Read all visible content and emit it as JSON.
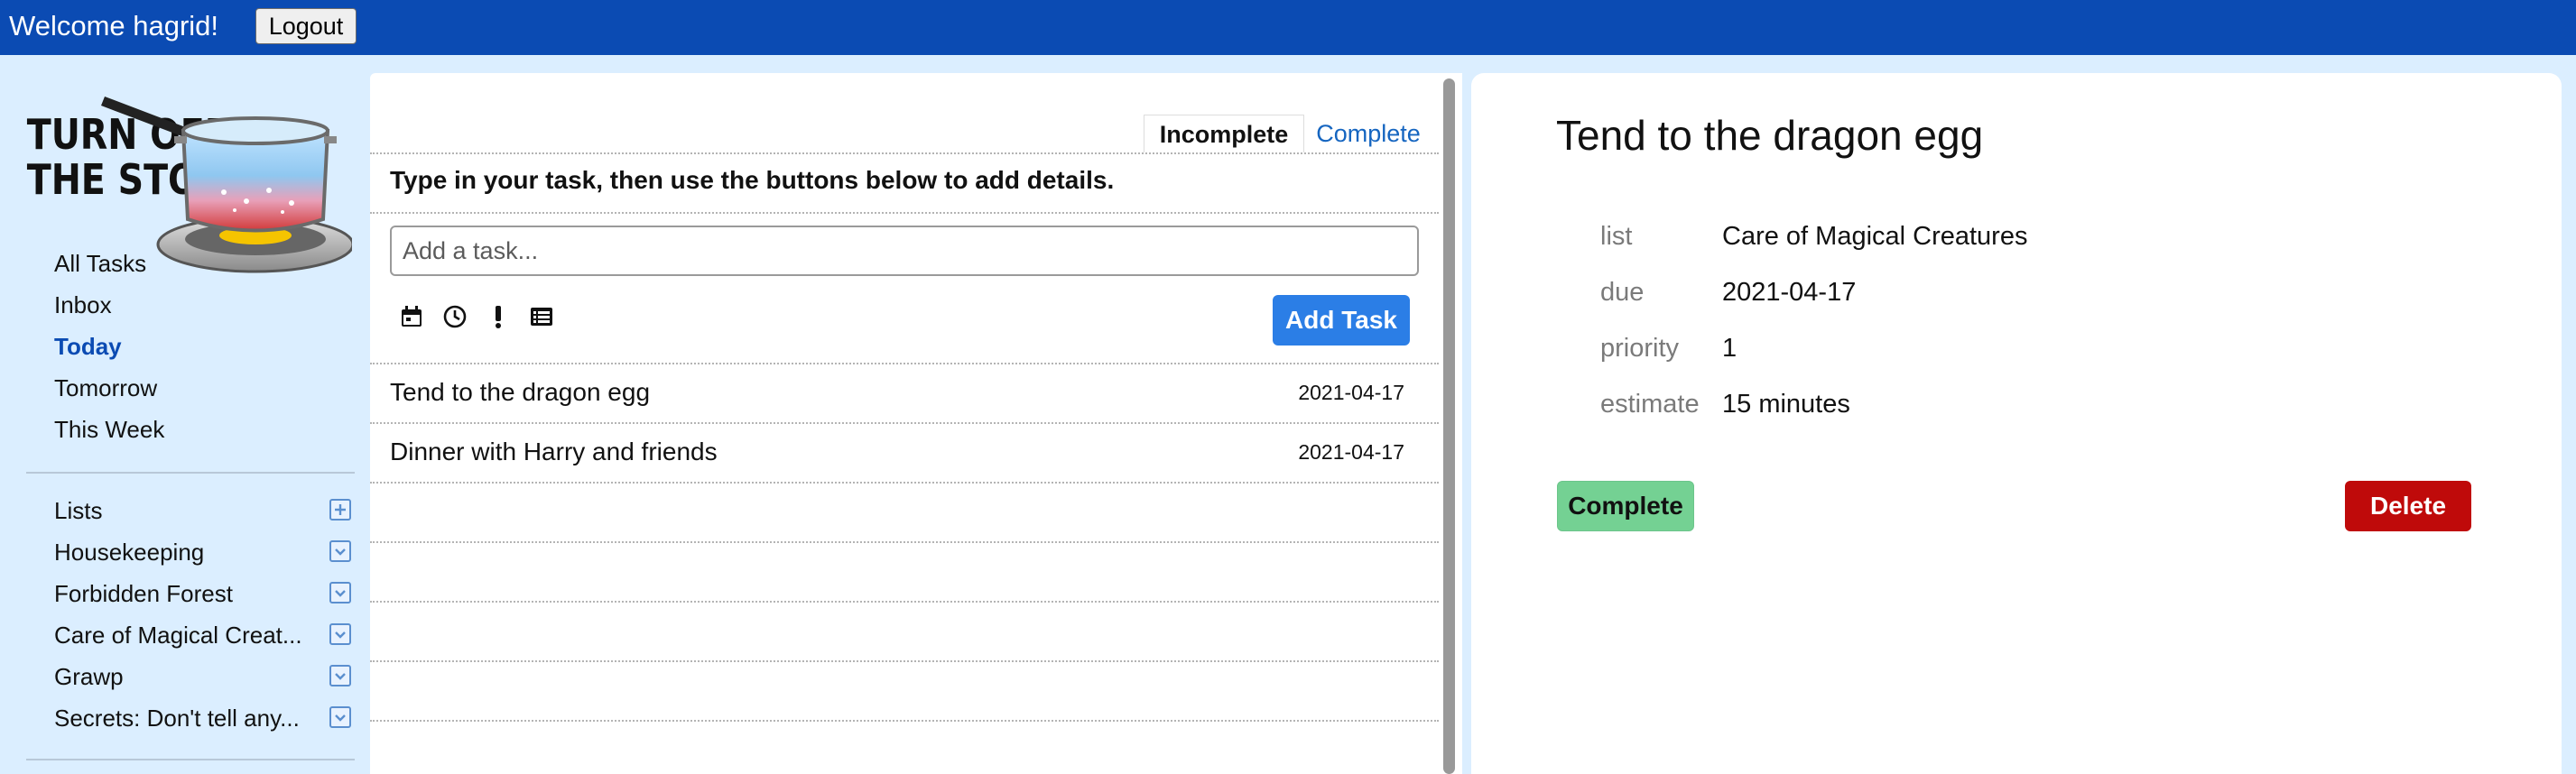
{
  "topbar": {
    "welcome": "Welcome hagrid!",
    "logout_label": "Logout",
    "color": "#0b4bb3"
  },
  "sidebar": {
    "logo": {
      "line1": "TURN OFF",
      "line2": "THE STOVE",
      "icon": "stove-pot-logo"
    },
    "nav": [
      {
        "label": "All Tasks",
        "active": false
      },
      {
        "label": "Inbox",
        "active": false
      },
      {
        "label": "Today",
        "active": true
      },
      {
        "label": "Tomorrow",
        "active": false
      },
      {
        "label": "This Week",
        "active": false
      }
    ],
    "lists_header": "Lists",
    "lists_add_icon": "plus-box-icon",
    "lists": [
      {
        "label": "Housekeeping",
        "icon": "chevron-down-box-icon"
      },
      {
        "label": "Forbidden Forest",
        "icon": "chevron-down-box-icon"
      },
      {
        "label": "Care of Magical Creat...",
        "icon": "chevron-down-box-icon"
      },
      {
        "label": "Grawp",
        "icon": "chevron-down-box-icon"
      },
      {
        "label": "Secrets: Don't tell any...",
        "icon": "chevron-down-box-icon"
      }
    ]
  },
  "main": {
    "tabs": [
      {
        "label": "Incomplete",
        "active": true
      },
      {
        "label": "Complete",
        "active": false
      }
    ],
    "instruction": "Type in your task, then use the buttons below to add details.",
    "input_placeholder": "Add a task...",
    "toolbar_icons": [
      "calendar-icon",
      "clock-icon",
      "exclamation-icon",
      "list-icon"
    ],
    "add_task_label": "Add Task",
    "tasks": [
      {
        "title": "Tend to the dragon egg",
        "date": "2021-04-17"
      },
      {
        "title": "Dinner with Harry and friends",
        "date": "2021-04-17"
      }
    ]
  },
  "detail": {
    "title": "Tend to the dragon egg",
    "fields": [
      {
        "label": "list",
        "value": "Care of Magical Creatures"
      },
      {
        "label": "due",
        "value": "2021-04-17"
      },
      {
        "label": "priority",
        "value": "1"
      },
      {
        "label": "estimate",
        "value": "15 minutes"
      }
    ],
    "complete_label": "Complete",
    "delete_label": "Delete",
    "complete_color": "#74d193",
    "delete_color": "#bf0a0a"
  }
}
